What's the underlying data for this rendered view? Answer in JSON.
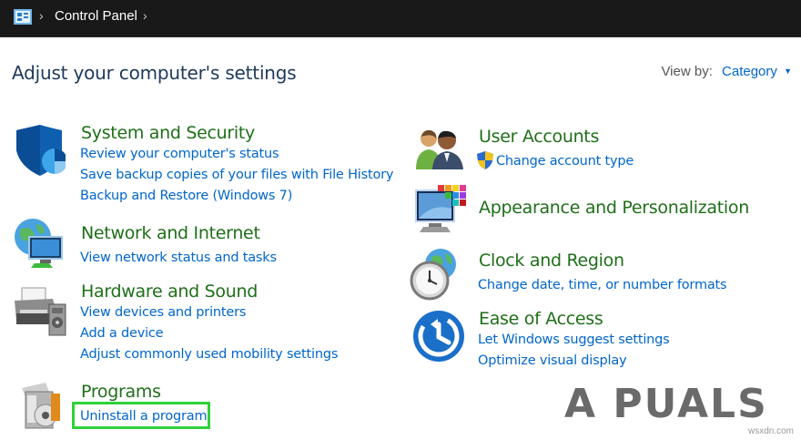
{
  "address_bar": {
    "crumb": "Control Panel"
  },
  "page": {
    "title": "Adjust your computer's settings",
    "view_by_label": "View by:",
    "view_by_value": "Category"
  },
  "categories": {
    "system": {
      "title": "System and Security",
      "links": [
        "Review your computer's status",
        "Save backup copies of your files with File History",
        "Backup and Restore (Windows 7)"
      ]
    },
    "network": {
      "title": "Network and Internet",
      "links": [
        "View network status and tasks"
      ]
    },
    "hardware": {
      "title": "Hardware and Sound",
      "links": [
        "View devices and printers",
        "Add a device",
        "Adjust commonly used mobility settings"
      ]
    },
    "programs": {
      "title": "Programs",
      "links": [
        "Uninstall a program"
      ]
    },
    "users": {
      "title": "User Accounts",
      "links": [
        "Change account type"
      ]
    },
    "appearance": {
      "title": "Appearance and Personalization",
      "links": []
    },
    "clock": {
      "title": "Clock and Region",
      "links": [
        "Change date, time, or number formats"
      ]
    },
    "ease": {
      "title": "Ease of Access",
      "links": [
        "Let Windows suggest settings",
        "Optimize visual display"
      ]
    }
  },
  "watermark": {
    "text": "A PUALS",
    "site": "wsxdn.com"
  },
  "colors": {
    "heading": "#1e6f18",
    "link": "#0066cc",
    "title": "#1e395b",
    "highlight": "#2fd13a"
  }
}
